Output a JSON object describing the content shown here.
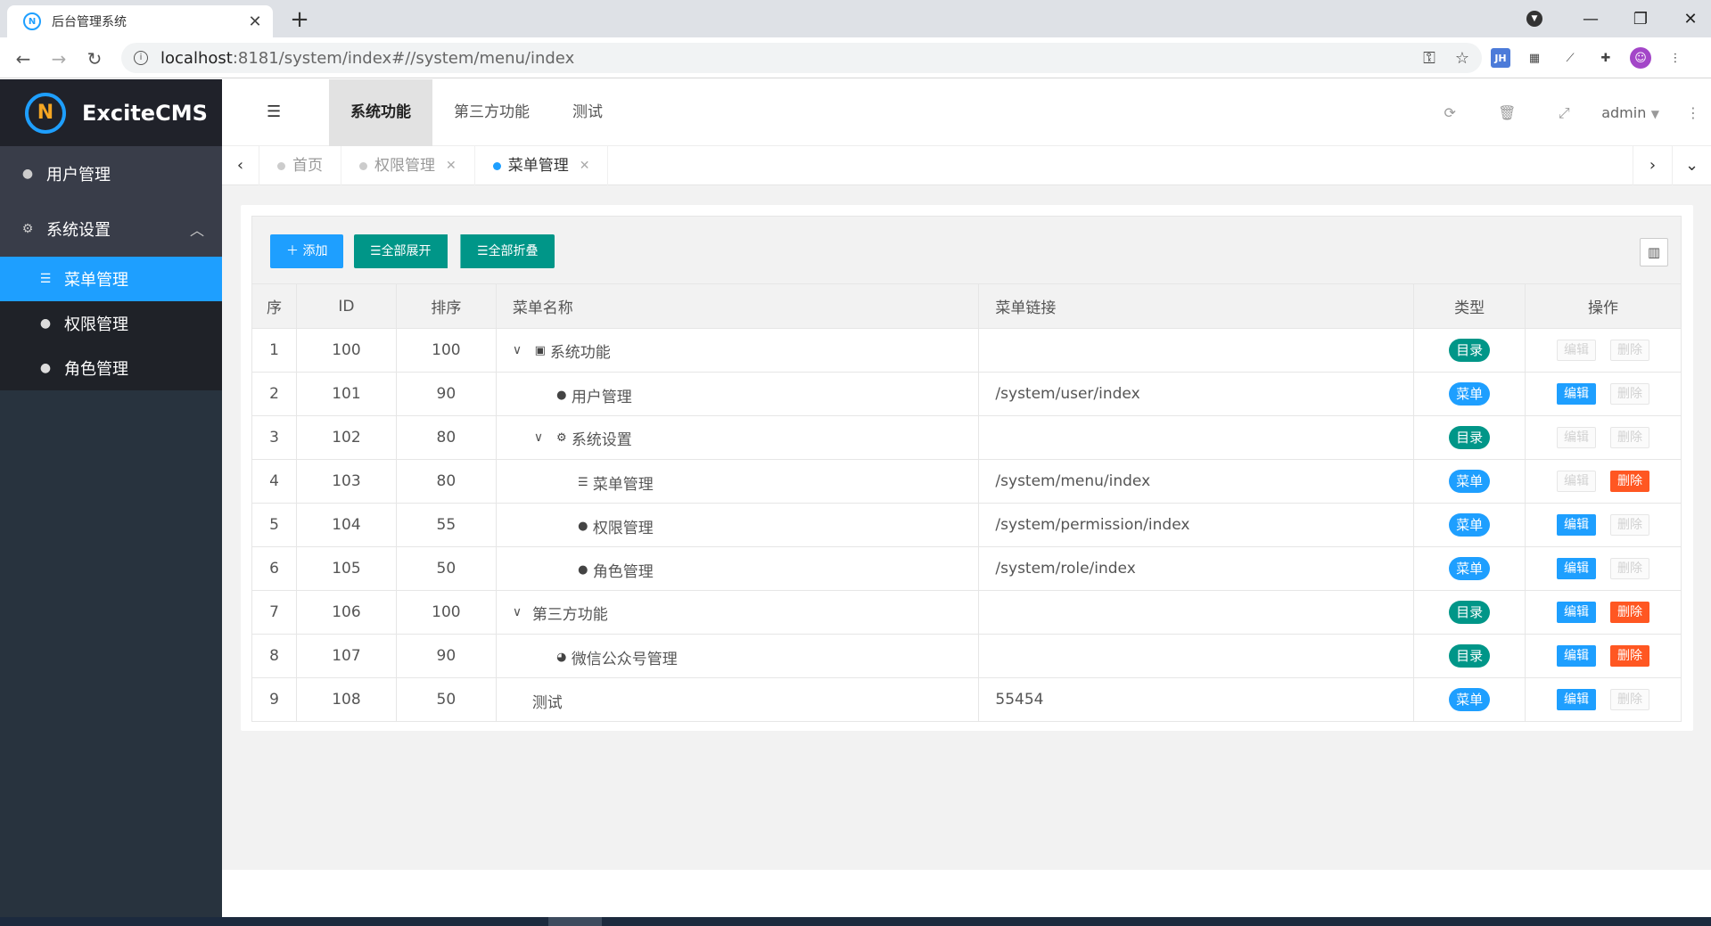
{
  "browser": {
    "tab_title": "后台管理系统",
    "url_host": "localhost",
    "url_path": ":8181/system/index#//system/menu/index",
    "ext_jh": "JH"
  },
  "sidebar": {
    "brand": "ExciteCMS",
    "logo_text": "N",
    "items": [
      {
        "label": "用户管理"
      },
      {
        "label": "系统设置"
      }
    ],
    "sub_items": [
      {
        "label": "菜单管理"
      },
      {
        "label": "权限管理"
      },
      {
        "label": "角色管理"
      }
    ]
  },
  "header": {
    "nav": [
      "系统功能",
      "第三方功能",
      "测试"
    ],
    "user": "admin"
  },
  "page_tabs": [
    {
      "label": "首页"
    },
    {
      "label": "权限管理"
    },
    {
      "label": "菜单管理"
    }
  ],
  "toolbar": {
    "add": "添加",
    "expand_all": "全部展开",
    "collapse_all": "全部折叠"
  },
  "table": {
    "headers": [
      "序",
      "ID",
      "排序",
      "菜单名称",
      "菜单链接",
      "类型",
      "操作"
    ],
    "edit_label": "编辑",
    "delete_label": "删除",
    "rows": [
      {
        "seq": "1",
        "id": "100",
        "order": "100",
        "name": "系统功能",
        "link": "",
        "type": "目录",
        "type_kind": "dir",
        "level": 0,
        "arrow": true,
        "icon": "book-icon",
        "edit": false,
        "del": false
      },
      {
        "seq": "2",
        "id": "101",
        "order": "90",
        "name": "用户管理",
        "link": "/system/user/index",
        "type": "菜单",
        "type_kind": "menu",
        "level": 1,
        "arrow": false,
        "icon": "user-icon",
        "edit": true,
        "del": false
      },
      {
        "seq": "3",
        "id": "102",
        "order": "80",
        "name": "系统设置",
        "link": "",
        "type": "目录",
        "type_kind": "dir",
        "level": 1,
        "arrow": true,
        "icon": "gears-icon",
        "edit": false,
        "del": false
      },
      {
        "seq": "4",
        "id": "103",
        "order": "80",
        "name": "菜单管理",
        "link": "/system/menu/index",
        "type": "菜单",
        "type_kind": "menu",
        "level": 2,
        "arrow": false,
        "icon": "list-icon",
        "edit": false,
        "del": true
      },
      {
        "seq": "5",
        "id": "104",
        "order": "55",
        "name": "权限管理",
        "link": "/system/permission/index",
        "type": "菜单",
        "type_kind": "menu",
        "level": 2,
        "arrow": false,
        "icon": "users-icon",
        "edit": true,
        "del": false
      },
      {
        "seq": "6",
        "id": "105",
        "order": "50",
        "name": "角色管理",
        "link": "/system/role/index",
        "type": "菜单",
        "type_kind": "menu",
        "level": 2,
        "arrow": false,
        "icon": "user-icon",
        "edit": true,
        "del": false
      },
      {
        "seq": "7",
        "id": "106",
        "order": "100",
        "name": "第三方功能",
        "link": "",
        "type": "目录",
        "type_kind": "dir",
        "level": 0,
        "arrow": true,
        "icon": "",
        "edit": true,
        "del": true
      },
      {
        "seq": "8",
        "id": "107",
        "order": "90",
        "name": "微信公众号管理",
        "link": "",
        "type": "目录",
        "type_kind": "dir",
        "level": 1,
        "arrow": false,
        "icon": "wechat-icon",
        "edit": true,
        "del": true
      },
      {
        "seq": "9",
        "id": "108",
        "order": "50",
        "name": "测试",
        "link": "55454",
        "type": "菜单",
        "type_kind": "menu",
        "level": 0,
        "arrow": false,
        "icon": "",
        "edit": true,
        "del": false
      }
    ]
  },
  "colors": {
    "primary": "#1e9fff",
    "teal": "#009688",
    "danger": "#ff5722",
    "sidebar": "#28333e"
  }
}
